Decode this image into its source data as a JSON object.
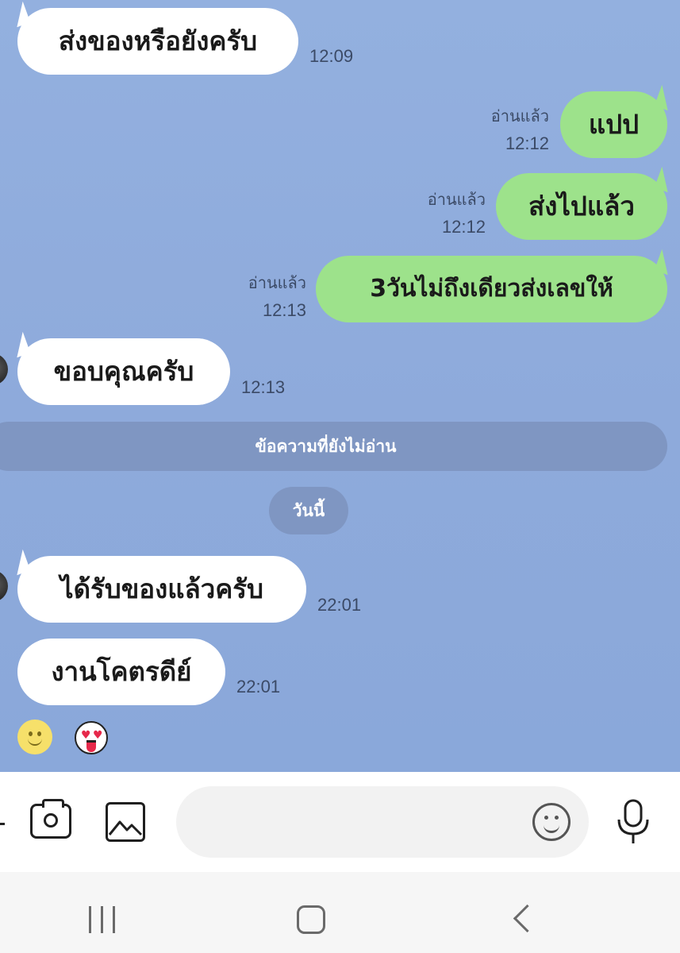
{
  "chat": {
    "messages": [
      {
        "direction": "incoming",
        "text": "ส่งของหรือยังครับ",
        "time": "12:09"
      },
      {
        "direction": "outgoing",
        "text": "แปป",
        "read": "อ่านแล้ว",
        "time": "12:12"
      },
      {
        "direction": "outgoing",
        "text": "ส่งไปแล้ว",
        "read": "อ่านแล้ว",
        "time": "12:12"
      },
      {
        "direction": "outgoing",
        "text": "3วันไม่ถึงเดียวส่งเลขให้",
        "read": "อ่านแล้ว",
        "time": "12:13"
      },
      {
        "direction": "incoming",
        "text": "ขอบคุณครับ",
        "time": "12:13"
      },
      {
        "direction": "incoming",
        "text": "ได้รับของแล้วครับ",
        "time": "22:01"
      },
      {
        "direction": "incoming",
        "text": "งานโคตรดีย์",
        "time": "22:01"
      }
    ],
    "unread_divider": "ข้อความที่ยังไม่อ่าน",
    "date_label": "วันนี้",
    "reactions": [
      "smile-emoji",
      "heart-eyes-emoji"
    ]
  },
  "input_bar": {
    "value": "",
    "icons": [
      "camera-icon",
      "gallery-icon",
      "emoji-icon",
      "microphone-icon"
    ]
  },
  "nav_bar": {
    "icons": [
      "recent-apps-icon",
      "home-icon",
      "back-icon"
    ]
  },
  "colors": {
    "chat_background": "#8eaadb",
    "incoming_bubble": "#ffffff",
    "outgoing_bubble": "#9de28b",
    "divider": "#7f96c2"
  }
}
